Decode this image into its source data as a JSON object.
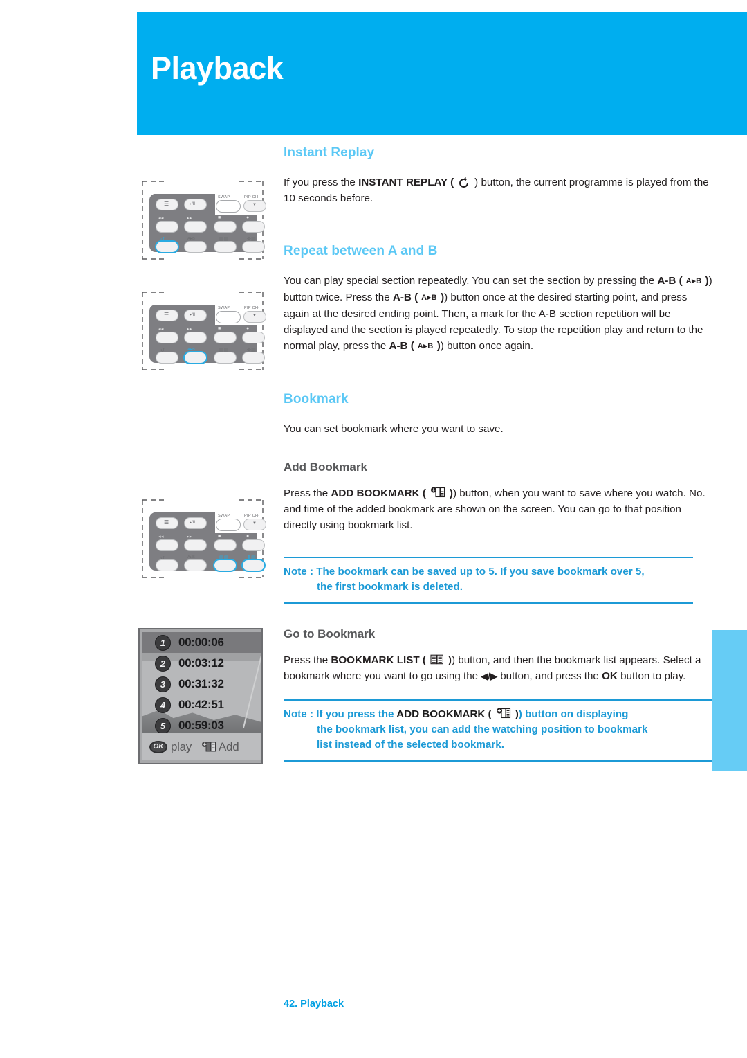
{
  "header": {
    "title": "Playback",
    "bg_color": "#00AEEF"
  },
  "side_tab": {
    "color": "#66CCF5"
  },
  "sections": {
    "instant_replay": {
      "heading": "Instant Replay",
      "p1_a": "If you press the ",
      "p1_b": "INSTANT REPLAY (",
      "p1_icon": "instant-replay-icon",
      "p1_c": ") button, the current programme is played from the 10 seconds before."
    },
    "repeat_ab": {
      "heading": "Repeat between A and B",
      "t1": "You can play special section repeatedly. You can set the section by pressing the ",
      "t2": "A-B (",
      "ab_icon": "A▸B",
      "t3": ") button twice. Press the ",
      "t4": "A-B (",
      "t5": ") button once at the desired starting point, and press again at the desired ending point. Then, a mark for the A-B section repetition will be displayed and the section is played repeatedly. To stop the repetition play and return to the normal play, press the ",
      "t6": "A-B (",
      "t7": ") button once again."
    },
    "bookmark": {
      "heading": "Bookmark",
      "intro": "You can set bookmark where you want to save."
    },
    "add_bookmark": {
      "heading": "Add Bookmark",
      "t1": "Press the ",
      "t2": "ADD BOOKMARK (",
      "icon": "add-bookmark-icon",
      "t3": ") button, when you want to save where you watch. No. and time of the added bookmark are shown on the screen. You can go to that position directly using bookmark list."
    },
    "note1": {
      "line1": "Note : The bookmark can be saved up to 5. If you save bookmark over 5,",
      "line2": "the first bookmark is deleted."
    },
    "go_to_bookmark": {
      "heading": "Go to Bookmark",
      "t1": "Press the ",
      "t2": "BOOKMARK LIST (",
      "icon": "bookmark-list-icon",
      "t3": ") button, and then the bookmark list appears. Select a bookmark where you want to go using the ",
      "arrows": "◀/▶",
      "t4": " button, and press the ",
      "t5": "OK",
      "t6": " button to play."
    },
    "note2": {
      "l1_a": "Note : If you press the ",
      "l1_b": "ADD BOOKMARK (",
      "icon": "add-bookmark-icon",
      "l1_c": ") button on displaying",
      "l2": "the bookmark list, you can add the watching position to bookmark",
      "l3": "list instead of the selected bookmark."
    }
  },
  "remotes": {
    "labels": {
      "swap": "SWAP",
      "pip": "PIP CH-",
      "rew": "◂◂",
      "ff": "▸▸",
      "stop": "■",
      "rec": "●",
      "replay": "↺",
      "ab": "A▸B",
      "booklist": "⌸",
      "addbook": "⌸",
      "playpause": "▸/II",
      "menu": "☰"
    },
    "remote1": {
      "highlight": "instant-replay-button",
      "caption": "remote-instant-replay"
    },
    "remote2": {
      "highlight": "a-b-button",
      "caption": "remote-a-b"
    },
    "remote3": {
      "highlight": "bookmark-buttons",
      "caption": "remote-bookmark"
    }
  },
  "bookmark_screen": {
    "rows": [
      {
        "num": "1",
        "time": "00:00:06"
      },
      {
        "num": "2",
        "time": "00:03:12"
      },
      {
        "num": "3",
        "time": "00:31:32"
      },
      {
        "num": "4",
        "time": "00:42:51"
      },
      {
        "num": "5",
        "time": "00:59:03"
      }
    ],
    "ok_label": "OK",
    "play_label": "play",
    "add_label": "Add"
  },
  "footer": {
    "text": "42. Playback"
  }
}
